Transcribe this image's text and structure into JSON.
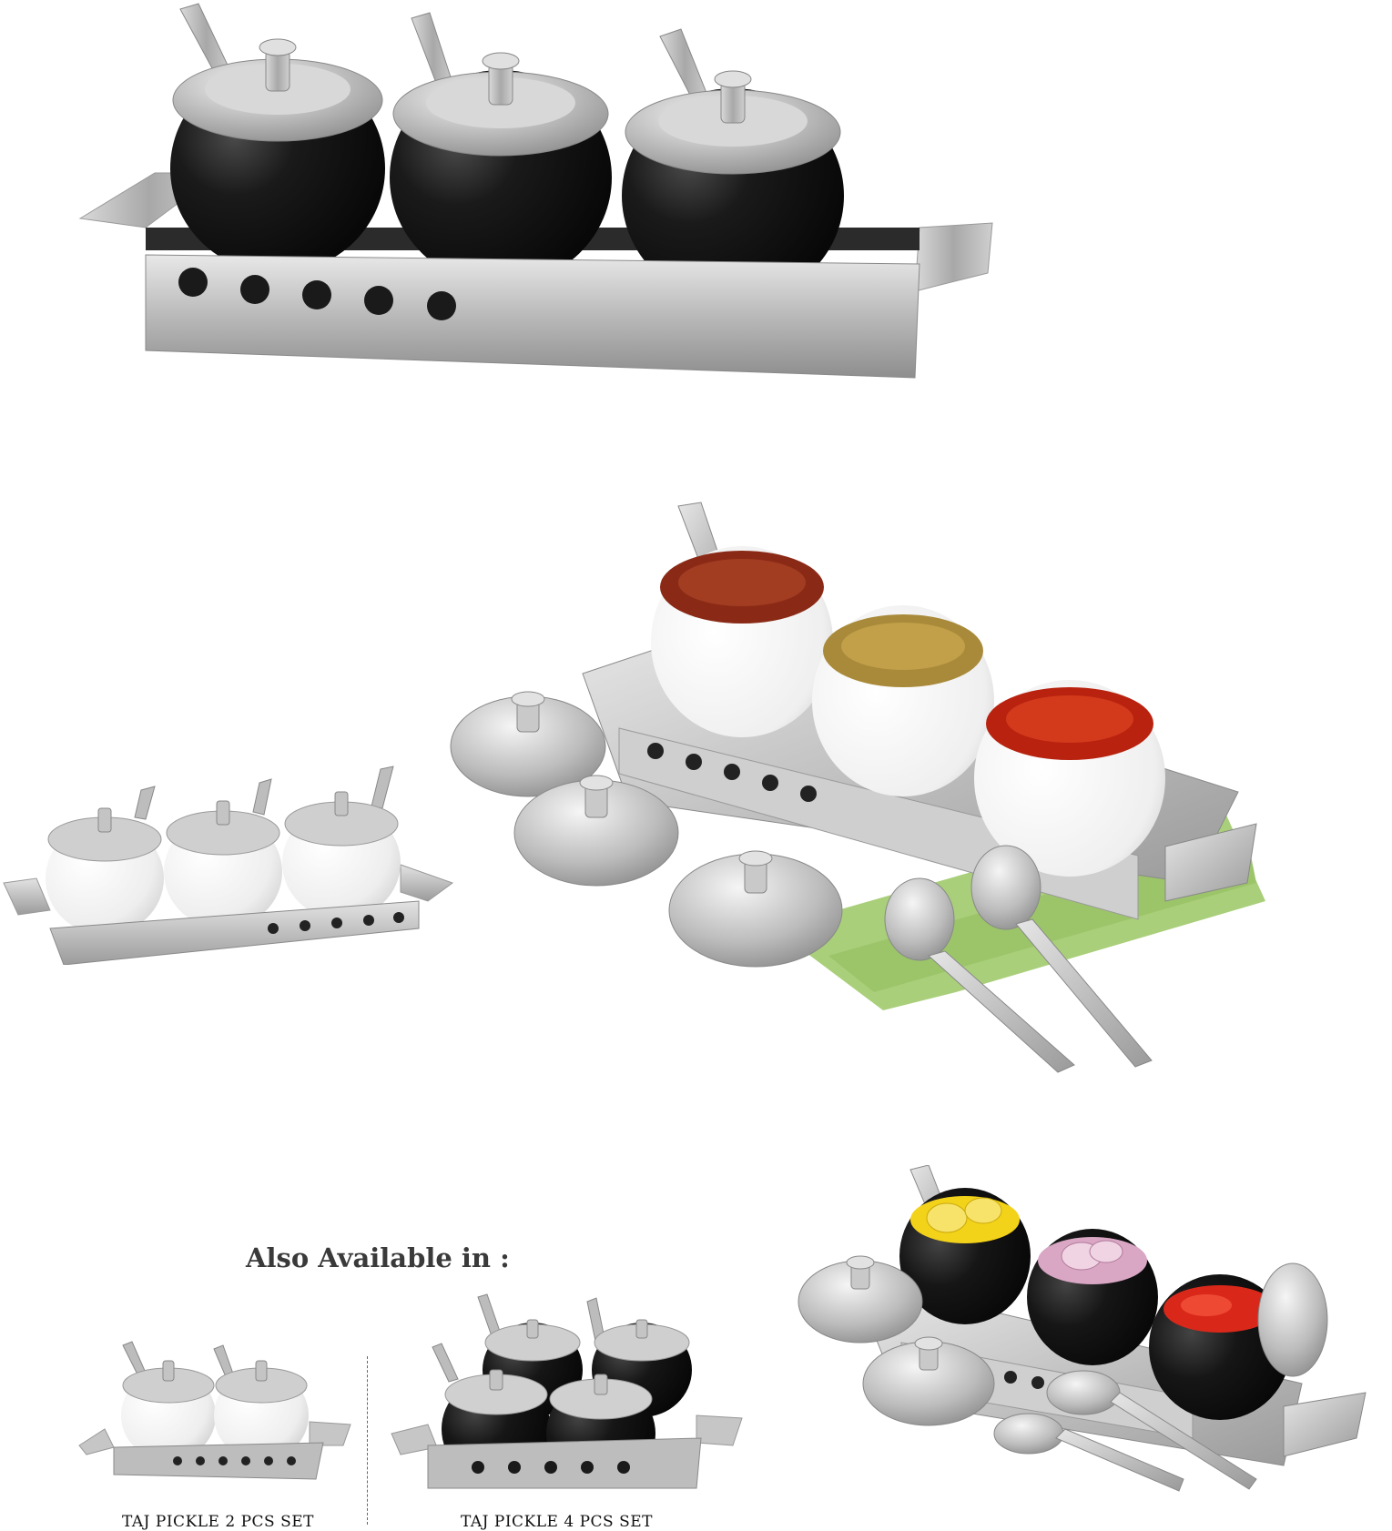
{
  "also_available_heading": "Also Available in :",
  "variants": [
    {
      "label": "TAJ PICKLE 2 PCS SET"
    },
    {
      "label": "TAJ PICKLE 4 PCS SET"
    }
  ],
  "colors": {
    "background": "#ffffff",
    "steel": "#c8c8c8",
    "black_jar": "#151515",
    "white_jar": "#f4f4f4",
    "napkin": "#a9cf7a"
  }
}
